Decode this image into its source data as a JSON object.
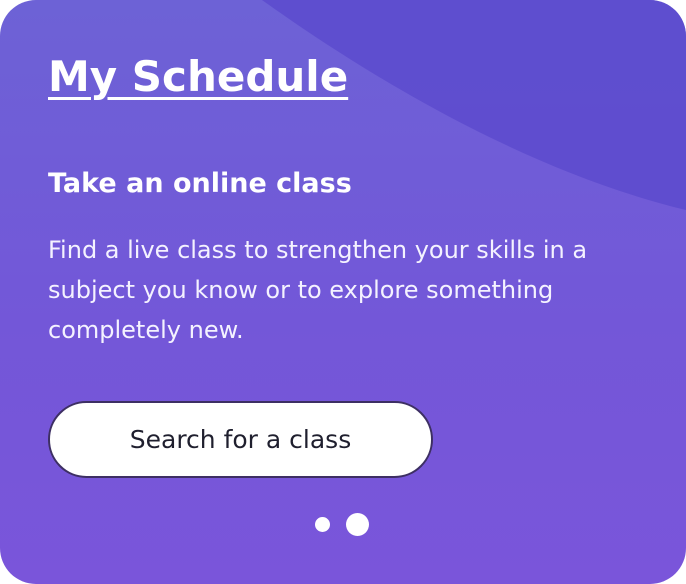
{
  "card": {
    "title": "My Schedule",
    "subtitle": "Take an online class",
    "description": "Find a live class to strengthen your skills in a subject you know or to explore something completely new.",
    "cta_label": "Search for a class",
    "pager": {
      "count": 2,
      "active_index": 1
    }
  },
  "colors": {
    "background_gradient_start": "#6d62d6",
    "background_gradient_end": "#7a55da",
    "wave": "#5a48cc",
    "button_bg": "#ffffff",
    "button_text": "#1f1f2e",
    "text": "#ffffff"
  }
}
